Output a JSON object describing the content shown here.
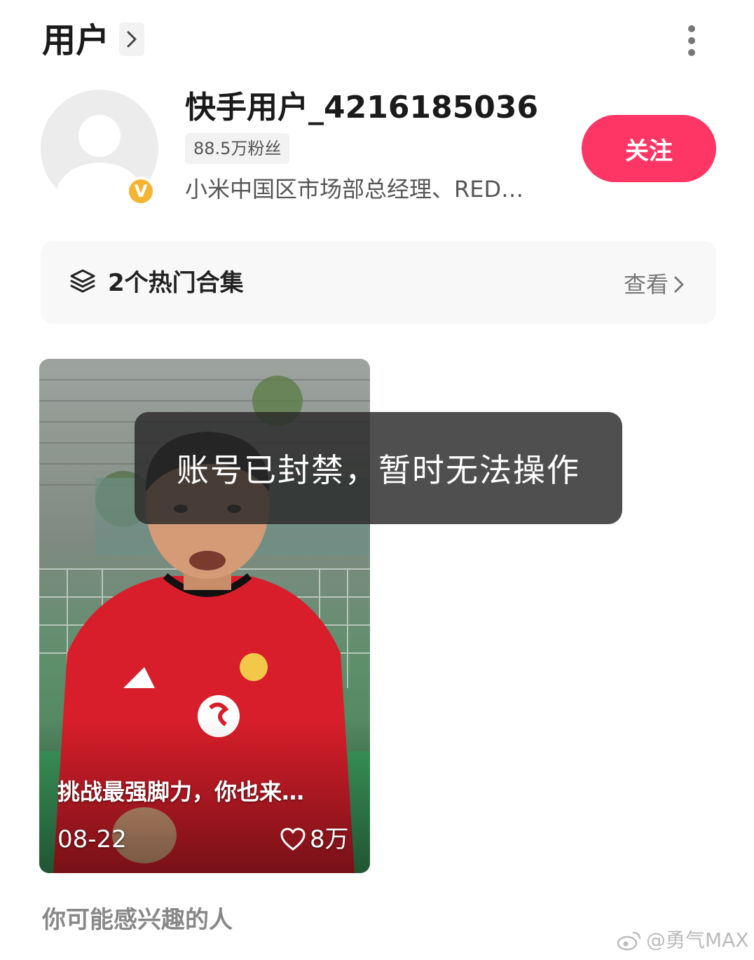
{
  "header": {
    "title": "用户",
    "more_icon": "more-vertical-icon"
  },
  "profile": {
    "username": "快手用户_4216185036",
    "fans": "88.5万粉丝",
    "bio": "小米中国区市场部总经理、RED…",
    "verified_mark": "V",
    "follow_label": "关注"
  },
  "collection": {
    "title": "2个热门合集",
    "view_label": "查看"
  },
  "video": {
    "title": "挑战最强脚力，你也来…",
    "date": "08-22",
    "likes": "8万",
    "colors": {
      "jersey": "#d81e2a",
      "wall": "#8d918e",
      "pitch": "#3c9a5c"
    }
  },
  "toast": {
    "message": "账号已封禁，暂时无法操作"
  },
  "suggestions": {
    "title": "你可能感兴趣的人"
  },
  "watermark": {
    "text": "@勇气MAX"
  },
  "colors": {
    "accent": "#fe3666",
    "verified": "#f4b431"
  }
}
